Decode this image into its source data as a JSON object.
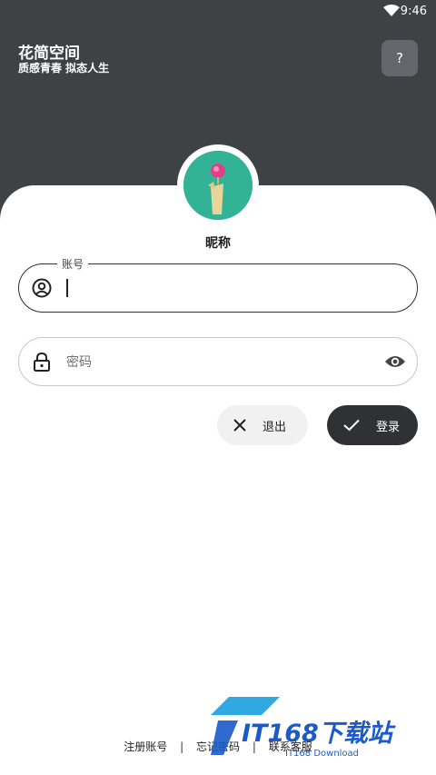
{
  "status_bar": {
    "time": "9:46",
    "wifi_icon": "wifi-icon"
  },
  "header": {
    "app_title": "花简空间",
    "app_subtitle": "质感青春 拟态人生",
    "help_label": "?"
  },
  "profile": {
    "nickname": "昵称"
  },
  "form": {
    "account_label": "账号",
    "account_value": "",
    "account_icon": "user-circle-icon",
    "password_placeholder": "密码",
    "password_icon": "lock-icon",
    "visibility_icon": "eye-icon"
  },
  "actions": {
    "exit_label": "退出",
    "exit_icon": "close-icon",
    "login_label": "登录",
    "login_icon": "check-icon"
  },
  "footer": {
    "register": "注册账号",
    "separator": "|",
    "forgot": "忘记密码",
    "contact": "联系客服"
  },
  "watermark": {
    "main": "IT168下载站",
    "sub": "IT168 Download"
  },
  "colors": {
    "header_bg": "#3f4245",
    "avatar_bg": "#33b395",
    "login_bg": "#2f3134",
    "watermark": "#1a5ac9"
  }
}
